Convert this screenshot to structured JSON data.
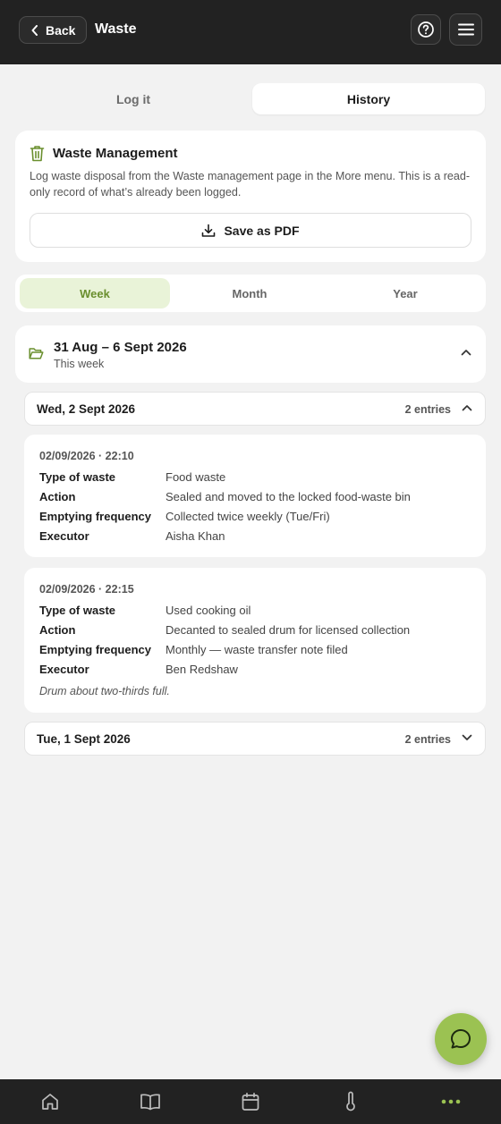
{
  "header": {
    "back_label": "Back",
    "title": "Waste",
    "help_icon": "question-circle-icon",
    "menu_icon": "hamburger-menu-icon"
  },
  "mode_tabs": [
    {
      "label": "Log it",
      "active": false
    },
    {
      "label": "History",
      "active": true
    }
  ],
  "info_card": {
    "icon": "trash-icon",
    "title": "Waste Management",
    "description": "Log waste disposal from the Waste management page in the More menu. This is a read-only record of what’s already been logged.",
    "pdf_label": "Save as PDF",
    "pdf_icon": "download-icon"
  },
  "period_tabs": [
    {
      "label": "Week",
      "active": true
    },
    {
      "label": "Month",
      "active": false
    },
    {
      "label": "Year",
      "active": false
    }
  ],
  "range": {
    "title": "31 Aug – 6 Sept 2026",
    "subtitle": "This week",
    "icon": "folder-open-icon"
  },
  "days": [
    {
      "title": "Wed, 2 Sept 2026",
      "count": "2 entries",
      "expanded": true,
      "entries": [
        {
          "time": "02/09/2026 · 22:10",
          "fields": [
            {
              "k": "Type of waste",
              "v": "Food waste"
            },
            {
              "k": "Action",
              "v": "Sealed and moved to the locked food-waste bin"
            },
            {
              "k": "Emptying frequency",
              "v": "Collected twice weekly (Tue/Fri)"
            },
            {
              "k": "Executor",
              "v": "Aisha Khan"
            }
          ]
        },
        {
          "time": "02/09/2026 · 22:15",
          "fields": [
            {
              "k": "Type of waste",
              "v": "Used cooking oil"
            },
            {
              "k": "Action",
              "v": "Decanted to sealed drum for licensed collection"
            },
            {
              "k": "Emptying frequency",
              "v": "Monthly — waste transfer note filed"
            },
            {
              "k": "Executor",
              "v": "Ben Redshaw"
            }
          ],
          "note": "Drum about two-thirds full."
        }
      ]
    },
    {
      "title": "Tue, 1 Sept 2026",
      "count": "2 entries",
      "expanded": false
    }
  ],
  "fab_icon": "chat-bubble-icon",
  "bottom_nav": [
    "home-icon",
    "book-icon",
    "calendar-icon",
    "thermometer-icon",
    "more-dots-icon"
  ],
  "colors": {
    "accent": "#9bc252",
    "accent_text": "#6a8f2e",
    "header_bg": "#222222",
    "page_bg": "#f2f2f2"
  }
}
